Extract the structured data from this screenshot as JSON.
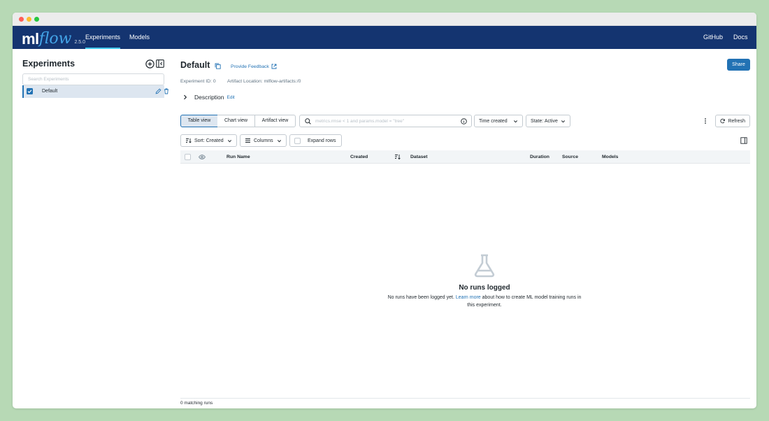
{
  "app": {
    "logo_ml": "ml",
    "logo_flow": "flow",
    "version": "2.5.0"
  },
  "nav": {
    "items": [
      {
        "label": "Experiments",
        "active": true
      },
      {
        "label": "Models",
        "active": false
      }
    ],
    "right": [
      {
        "label": "GitHub"
      },
      {
        "label": "Docs"
      }
    ]
  },
  "sidebar": {
    "title": "Experiments",
    "search_placeholder": "Search Experiments",
    "experiments": [
      {
        "name": "Default",
        "checked": true,
        "selected": true
      }
    ]
  },
  "experiment": {
    "title": "Default",
    "feedback_label": "Provide Feedback",
    "share_label": "Share",
    "id_text": "Experiment ID: 0",
    "artifact_text": "Artifact Location: mlflow-artifacts:/0",
    "description_label": "Description",
    "description_edit": "Edit"
  },
  "toolbar": {
    "views": [
      "Table view",
      "Chart view",
      "Artifact view"
    ],
    "active_view": "Table view",
    "search_placeholder": "metrics.rmse < 1 and params.model = \"tree\"",
    "time_filter": "Time created",
    "state_filter": "State: Active",
    "refresh_label": "Refresh",
    "sort_label": "Sort: Created",
    "columns_label": "Columns",
    "expand_rows_label": "Expand rows"
  },
  "table": {
    "columns": [
      "Run Name",
      "Created",
      "Dataset",
      "Duration",
      "Source",
      "Models"
    ]
  },
  "empty_state": {
    "title": "No runs logged",
    "text_before": "No runs have been logged yet.",
    "link": "Learn more",
    "text_after": "about how to create ML model training runs in this experiment."
  },
  "footer": {
    "matching": "0 matching runs"
  },
  "colors": {
    "nav_bg": "#143470",
    "accent": "#2272b4",
    "active_underline": "#43c9ed",
    "page_bg": "#b7d9b5"
  }
}
